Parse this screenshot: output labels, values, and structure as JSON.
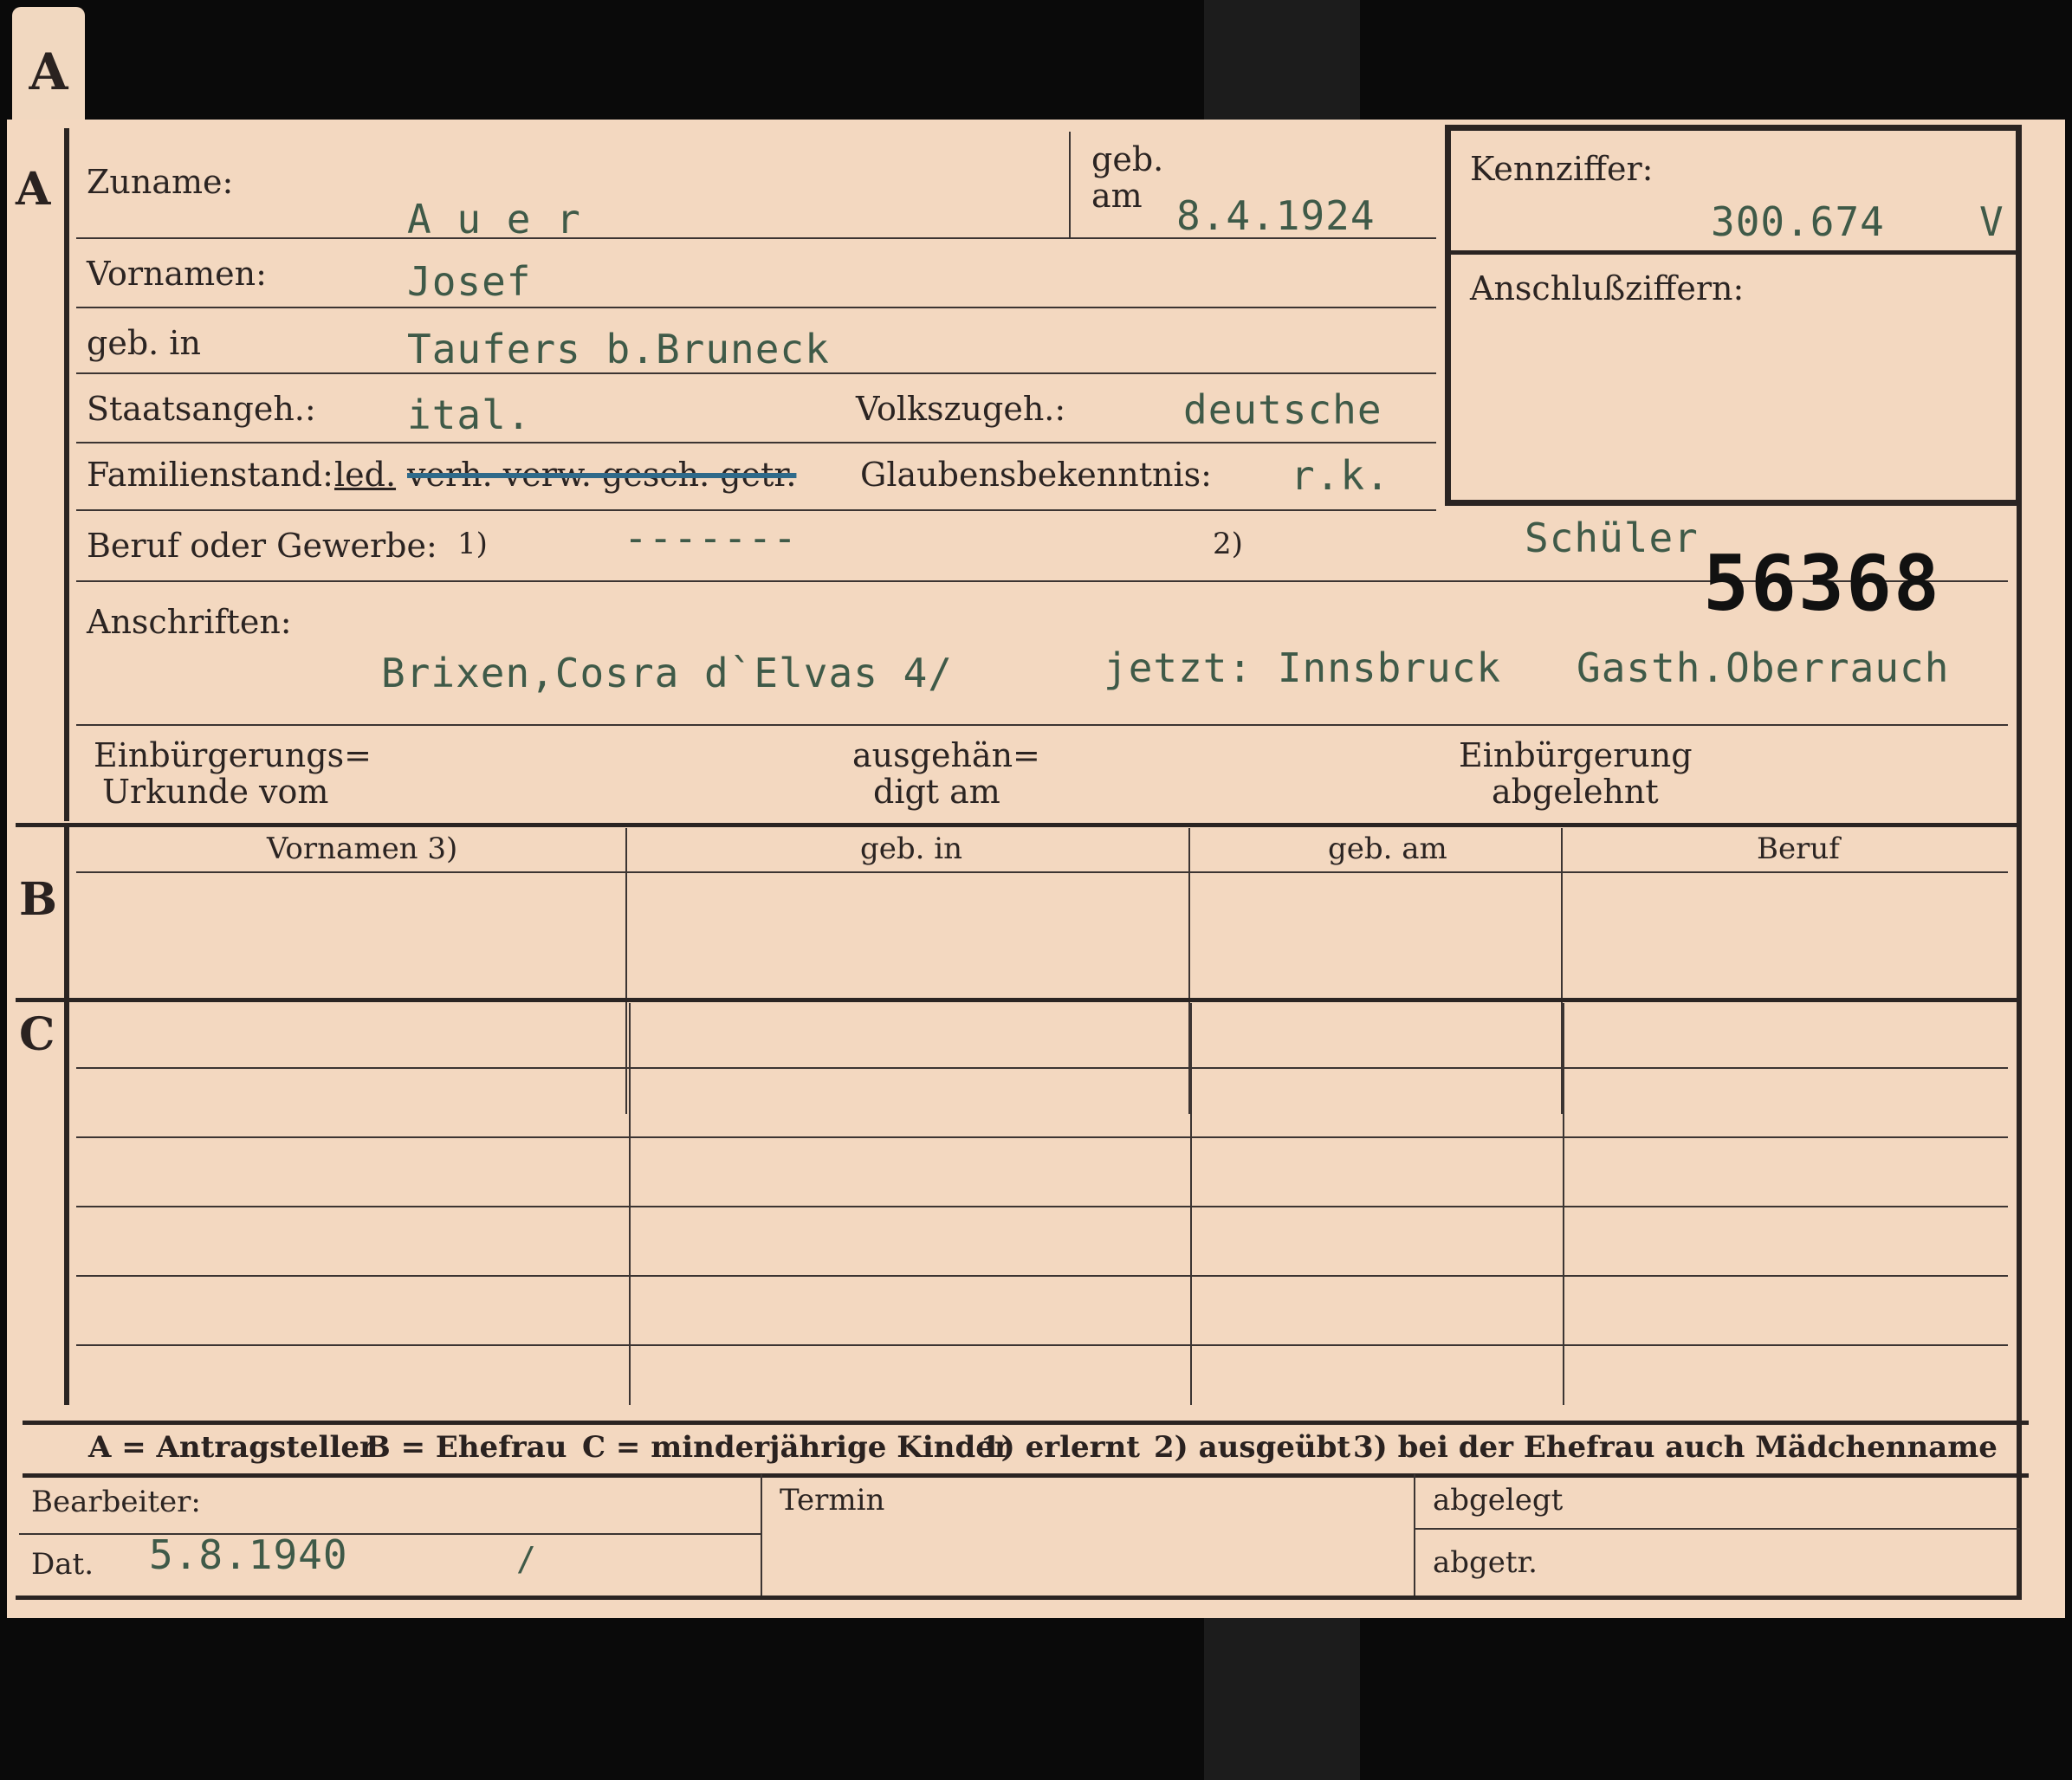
{
  "tab": {
    "letter": "A"
  },
  "section_a": {
    "marker": "A",
    "zuname_label": "Zuname:",
    "zuname_value": "A u e r",
    "geb_label_1": "geb.",
    "geb_label_2": "am",
    "geb_am_value": "8.4.1924",
    "vornamen_label": "Vornamen:",
    "vornamen_value": "Josef",
    "geb_in_label": "geb. in",
    "geb_in_value": "Taufers b.Bruneck",
    "staatsangeh_label": "Staatsangeh.:",
    "staatsangeh_value": "ital.",
    "volkszugeh_label": "Volkszugeh.:",
    "volkszugeh_value": "deutsche",
    "familienstand_label": "Familienstand:",
    "familienstand_value": "led.",
    "familienstand_struck": "verh. verw. gesch. getr.",
    "glaubens_label": "Glaubensbekenntnis:",
    "glaubens_value": "r.k.",
    "beruf_label": "Beruf oder Gewerbe:",
    "beruf_note1": "1)",
    "beruf_value1": "-------",
    "beruf_note2": "2)",
    "beruf_value2": "Schüler",
    "stamp_number": "56368",
    "anschriften_label": "Anschriften:",
    "anschrift_1": "Brixen,Cosra d`Elvas 4/",
    "anschrift_2": "jetzt: Innsbruck",
    "anschrift_3": "Gasth.Oberrauch",
    "einbuergerung_label_1": "Einbürgerungs=",
    "einbuergerung_label_2": "Urkunde vom",
    "ausgehaendigt_label_1": "ausgehän=",
    "ausgehaendigt_label_2": "digt am",
    "abgelehnt_label_1": "Einbürgerung",
    "abgelehnt_label_2": "abgelehnt",
    "kennziffer_label": "Kennziffer:",
    "kennziffer_value": "300.674",
    "kennziffer_suffix": "V",
    "anschlussziffern_label": "Anschlußziffern:"
  },
  "section_b": {
    "marker": "B",
    "columns": [
      "Vornamen 3)",
      "geb. in",
      "geb. am",
      "Beruf"
    ]
  },
  "section_c": {
    "marker": "C"
  },
  "legend": {
    "a": "A = Antragsteller",
    "b": "B = Ehefrau",
    "c": "C = minderjährige Kinder",
    "n1": "1) erlernt",
    "n2": "2) ausgeübt",
    "n3": "3) bei der Ehefrau auch Mädchenname"
  },
  "footer": {
    "bearbeiter_label": "Bearbeiter:",
    "dat_label": "Dat.",
    "dat_value": "5.8.1940",
    "dat_slash": "/",
    "termin_label": "Termin",
    "abgelegt_label": "abgelegt",
    "abgetr_label": "abgetr."
  },
  "colors": {
    "card": "#f3d8c0",
    "ink": "#2b2422",
    "typewriter": "#3f5a48",
    "stamp": "#111111"
  }
}
